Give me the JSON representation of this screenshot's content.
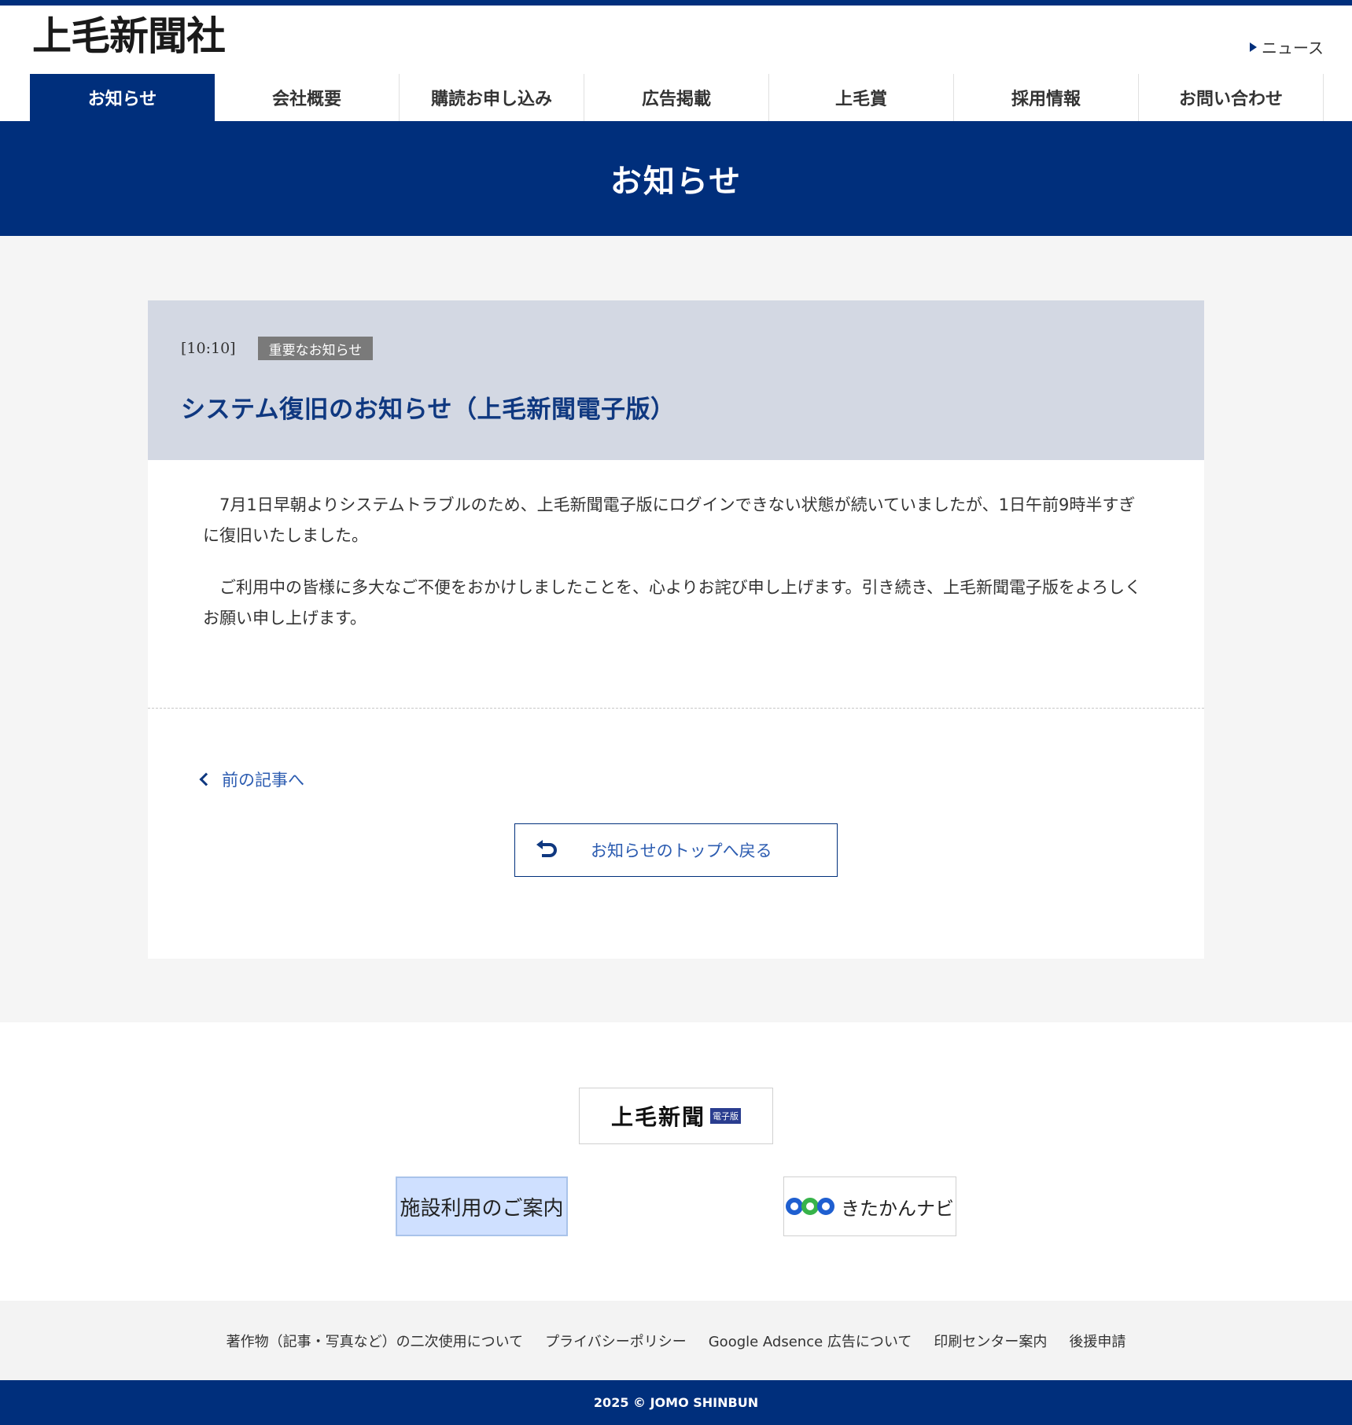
{
  "header": {
    "logo_text": "上毛新聞社",
    "news_link": "ニュース"
  },
  "nav": {
    "items": [
      {
        "label": "お知らせ",
        "active": true
      },
      {
        "label": "会社概要"
      },
      {
        "label": "購読お申し込み"
      },
      {
        "label": "広告掲載"
      },
      {
        "label": "上毛賞"
      },
      {
        "label": "採用情報"
      },
      {
        "label": "お問い合わせ"
      }
    ]
  },
  "hero": {
    "title": "お知らせ"
  },
  "article": {
    "time": "[10:10]",
    "badge": "重要なお知らせ",
    "title": "システム復旧のお知らせ（上毛新聞電子版）",
    "paragraphs": [
      "7月1日早朝よりシステムトラブルのため、上毛新聞電子版にログインできない状態が続いていましたが、1日午前9時半すぎに復旧いたしました。",
      "ご利用中の皆様に多大なご不便をおかけしましたことを、心よりお詫び申し上げます。引き続き、上毛新聞電子版をよろしくお願い申し上げます。"
    ],
    "prev_link": "前の記事へ",
    "back_button": "お知らせのトップへ戻る"
  },
  "banners": {
    "denshi_logo": "上毛新聞",
    "denshi_tag": "電子版",
    "facility": "施設利用のご案内",
    "kitakan": "きたかんナビ"
  },
  "footer": {
    "links": [
      "著作物（記事・写真など）の二次使用について",
      "プライバシーポリシー",
      "Google Adsence 広告について",
      "印刷センター案内",
      "後援申請"
    ],
    "copyright": "2025 © JOMO SHINBUN"
  },
  "colors": {
    "brand_navy": "#002f7c",
    "title_blue": "#0f3880",
    "link_blue": "#2b5bb0",
    "article_head_bg": "#d3d8e3"
  }
}
